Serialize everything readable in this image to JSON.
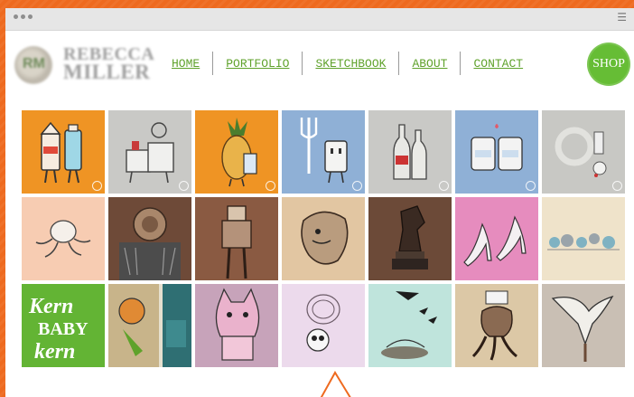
{
  "window": {
    "menu_icon": "hamburger-icon"
  },
  "logo": {
    "line1": "REBECCA",
    "line2": "MILLER",
    "mark": "RM"
  },
  "nav": {
    "items": [
      {
        "label": "HOME"
      },
      {
        "label": "PORTFOLIO"
      },
      {
        "label": "SKETCHBOOK"
      },
      {
        "label": "ABOUT"
      },
      {
        "label": "CONTACT"
      }
    ],
    "shop_label": "SHOP"
  },
  "colors": {
    "accent_green": "#5fa22b",
    "shop_green": "#66bd35",
    "frame_orange": "#ee6a1f"
  },
  "gallery": {
    "rows": [
      [
        "orange",
        "lightgray",
        "orange",
        "blue",
        "lightgray",
        "blue",
        "lightgray"
      ],
      [
        "peach",
        "brown",
        "brown",
        "tan",
        "brown",
        "pink",
        "cream"
      ],
      [
        "green",
        "multi",
        "mauve",
        "lavender",
        "mint",
        "tan",
        "taupe"
      ]
    ],
    "kern_text": [
      "Kern",
      "BABY",
      "kern"
    ]
  }
}
